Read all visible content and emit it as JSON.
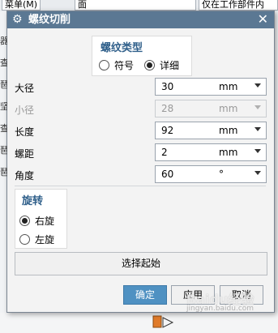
{
  "background": {
    "menu_text": "菜单(M)",
    "combo_text": "面",
    "filter_text": "仅在工作部件内",
    "left_glyphs": [
      "器",
      "查",
      "琶",
      "坚",
      "查",
      "琶",
      "琶"
    ]
  },
  "dialog": {
    "title": "螺纹切削",
    "thread_type": {
      "title": "螺纹类型",
      "options": [
        {
          "label": "符号",
          "selected": false
        },
        {
          "label": "详细",
          "selected": true
        }
      ]
    },
    "fields": [
      {
        "label": "大径",
        "value": "30",
        "unit": "mm",
        "disabled": false
      },
      {
        "label": "小径",
        "value": "28",
        "unit": "mm",
        "disabled": true
      },
      {
        "label": "长度",
        "value": "92",
        "unit": "mm",
        "disabled": false
      },
      {
        "label": "螺距",
        "value": "2",
        "unit": "mm",
        "disabled": false
      },
      {
        "label": "角度",
        "value": "60",
        "unit": "°",
        "disabled": false
      }
    ],
    "rotation": {
      "title": "旋转",
      "options": [
        {
          "label": "右旋",
          "selected": true
        },
        {
          "label": "左旋",
          "selected": false
        }
      ]
    },
    "select_start": "选择起始",
    "buttons": {
      "ok": "确定",
      "apply": "应用",
      "cancel": "取消"
    }
  },
  "watermark": {
    "text": "Baidu经验",
    "sub": "jingyan.baidu.com"
  },
  "colors": {
    "titlebar": "#5b7893",
    "accent": "#2f5f8a",
    "primary_button": "#4f91c2"
  }
}
